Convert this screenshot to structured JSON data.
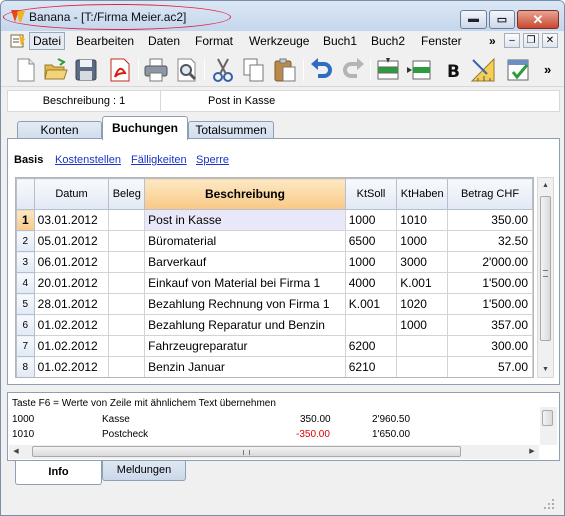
{
  "window": {
    "title": "Banana - [T:/Firma Meier.ac2]",
    "controls": {
      "minimize": "▬",
      "maximize": "▭",
      "close": "✕"
    }
  },
  "menu": {
    "items": [
      {
        "label": "Datei"
      },
      {
        "label": "Bearbeiten"
      },
      {
        "label": "Daten"
      },
      {
        "label": "Format"
      },
      {
        "label": "Werkzeuge"
      },
      {
        "label": "Buch1"
      },
      {
        "label": "Buch2"
      },
      {
        "label": "Fenster"
      }
    ],
    "overflow": "»",
    "mdi": {
      "minimize": "–",
      "restore": "❐",
      "close": "✕"
    }
  },
  "toolbar": {
    "icons": [
      "new-document-icon",
      "open-folder-icon",
      "save-disk-icon",
      "pdf-icon",
      "print-icon",
      "print-preview-icon",
      "cut-icon",
      "copy-icon",
      "paste-icon",
      "undo-icon",
      "redo-icon",
      "insert-row-icon",
      "delete-row-icon",
      "bold-icon",
      "format-icon",
      "check-icon"
    ],
    "bold_label": "B",
    "overflow": "»"
  },
  "fieldinfo": {
    "column_ref": "Beschreibung : 1",
    "content": "Post in Kasse"
  },
  "tabs": [
    {
      "label": "Konten"
    },
    {
      "label": "Buchungen"
    },
    {
      "label": "Totalsummen"
    }
  ],
  "views": {
    "active": "Basis",
    "links": [
      "Kostenstellen",
      "Fälligkeiten",
      "Sperre"
    ]
  },
  "table": {
    "columns": [
      "Datum",
      "Beleg",
      "Beschreibung",
      "KtSoll",
      "KtHaben",
      "Betrag CHF"
    ],
    "rows": [
      {
        "n": "1",
        "datum": "03.01.2012",
        "beleg": "",
        "beschreibung": "Post in Kasse",
        "soll": "1000",
        "haben": "1010",
        "betrag": "350.00"
      },
      {
        "n": "2",
        "datum": "05.01.2012",
        "beleg": "",
        "beschreibung": "Büromaterial",
        "soll": "6500",
        "haben": "1000",
        "betrag": "32.50"
      },
      {
        "n": "3",
        "datum": "06.01.2012",
        "beleg": "",
        "beschreibung": "Barverkauf",
        "soll": "1000",
        "haben": "3000",
        "betrag": "2'000.00"
      },
      {
        "n": "4",
        "datum": "20.01.2012",
        "beleg": "",
        "beschreibung": "Einkauf von Material bei Firma 1",
        "soll": "4000",
        "haben": "K.001",
        "betrag": "1'500.00"
      },
      {
        "n": "5",
        "datum": "28.01.2012",
        "beleg": "",
        "beschreibung": "Bezahlung Rechnung von Firma 1",
        "soll": "K.001",
        "haben": "1020",
        "betrag": "1'500.00"
      },
      {
        "n": "6",
        "datum": "01.02.2012",
        "beleg": "",
        "beschreibung": "Bezahlung Reparatur und Benzin",
        "soll": "",
        "haben": "1000",
        "betrag": "357.00"
      },
      {
        "n": "7",
        "datum": "01.02.2012",
        "beleg": "",
        "beschreibung": "Fahrzeugreparatur",
        "soll": "6200",
        "haben": "",
        "betrag": "300.00"
      },
      {
        "n": "8",
        "datum": "01.02.2012",
        "beleg": "",
        "beschreibung": "Benzin Januar",
        "soll": "6210",
        "haben": "",
        "betrag": "57.00"
      }
    ]
  },
  "info": {
    "hint": "Taste F6 = Werte von Zeile mit ähnlichem Text übernehmen",
    "lines": [
      {
        "account": "1000",
        "name": "Kasse",
        "amount": "350.00",
        "balance": "2'960.50"
      },
      {
        "account": "1010",
        "name": "Postcheck",
        "amount": "-350.00",
        "balance": "1'650.00"
      }
    ]
  },
  "bottom_tabs": [
    {
      "label": "Info"
    },
    {
      "label": "Meldungen"
    }
  ],
  "colors": {
    "sorted_header": "#f8c985",
    "selected_cell": "#e9e8f8",
    "negative": "#e00000",
    "link": "#1a35c8"
  }
}
